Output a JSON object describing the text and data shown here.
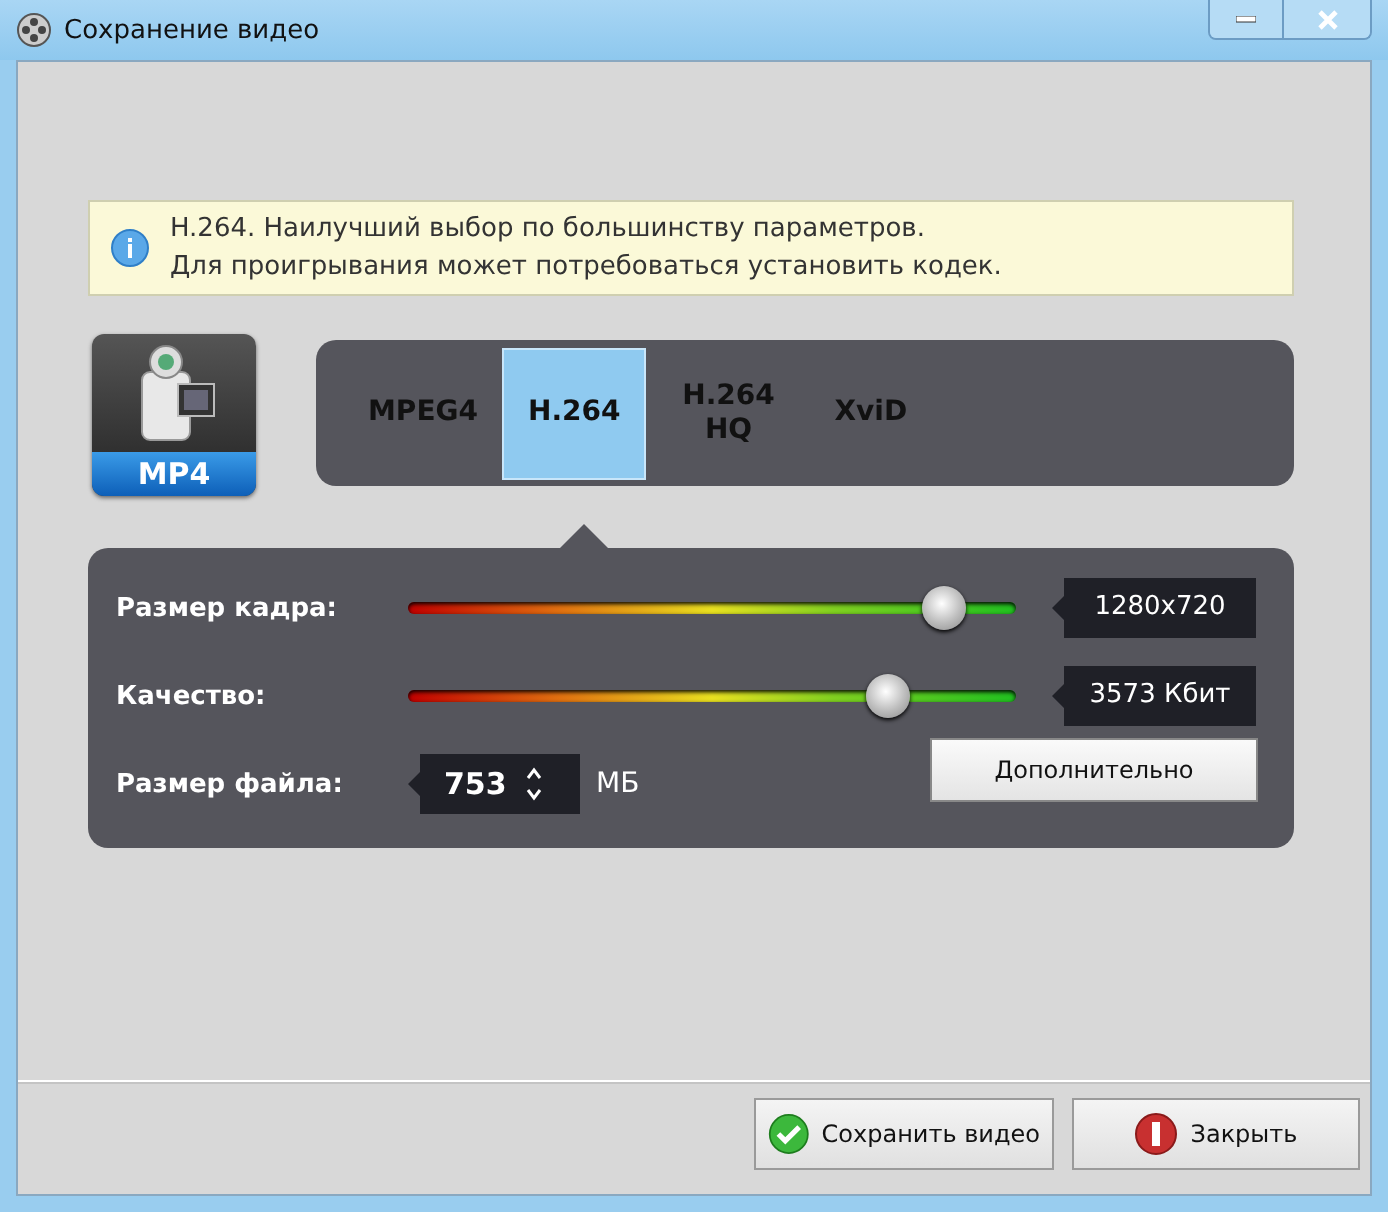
{
  "window": {
    "title": "Сохранение видео"
  },
  "info": {
    "lines": [
      "H.264. Наилучший выбор по большинству параметров.",
      "Для проигрывания может потребоваться установить кодек."
    ]
  },
  "format_badge": "MP4",
  "codecs": [
    {
      "label": "MPEG4",
      "selected": false
    },
    {
      "label": "H.264",
      "selected": true
    },
    {
      "label": "H.264 HQ",
      "selected": false
    },
    {
      "label": "XviD",
      "selected": false
    }
  ],
  "settings": {
    "sliders": [
      {
        "label": "Размер кадра:",
        "level": 0.88,
        "reading": "1280x720"
      },
      {
        "label": "Качество:",
        "level": 0.79,
        "reading": "3573 Кбит"
      }
    ],
    "file_size": {
      "label": "Размер файла:",
      "value": "753",
      "unit": "МБ"
    },
    "advanced_button": "Дополнительно"
  },
  "buttons": [
    {
      "label": "Сохранить видео",
      "kind": "save"
    },
    {
      "label": "Закрыть",
      "kind": "close"
    }
  ]
}
